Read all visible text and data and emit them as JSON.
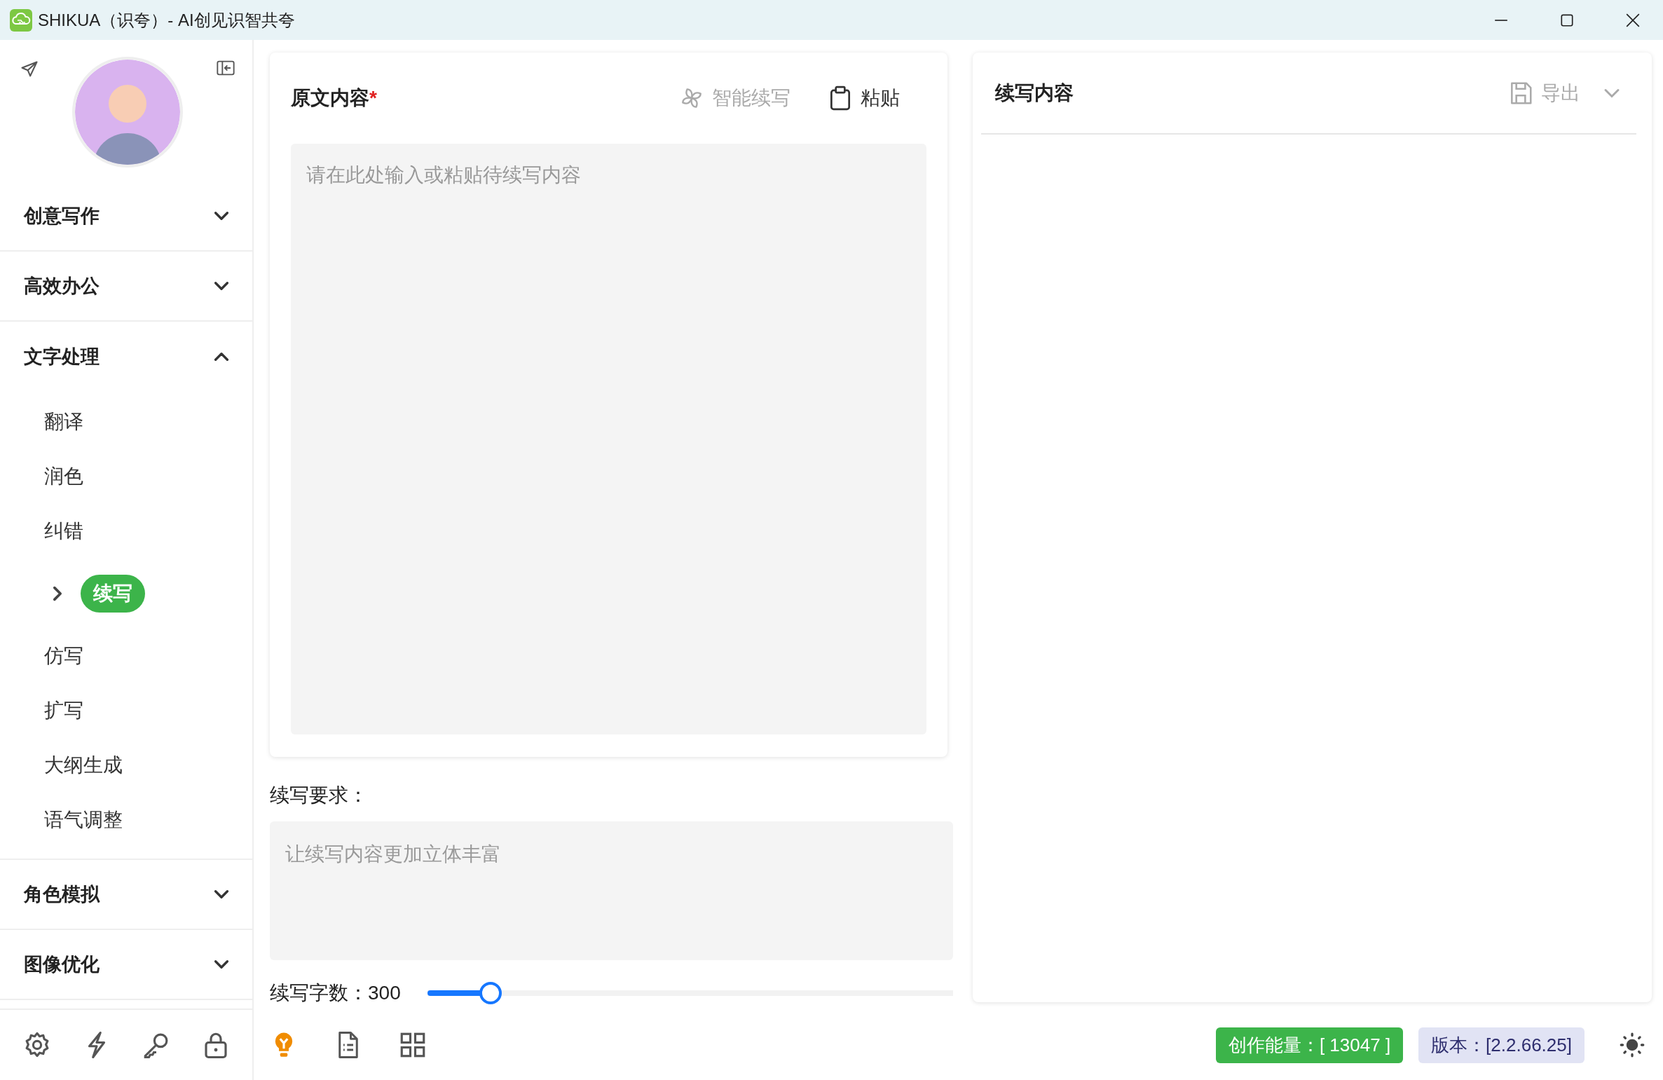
{
  "window": {
    "title": "SHIKUA（识夸）- AI创见识智共夸"
  },
  "sidebar": {
    "groups": [
      {
        "label": "创意写作",
        "expanded": false
      },
      {
        "label": "高效办公",
        "expanded": false
      },
      {
        "label": "文字处理",
        "expanded": true,
        "items": [
          {
            "label": "翻译",
            "selected": false
          },
          {
            "label": "润色",
            "selected": false
          },
          {
            "label": "纠错",
            "selected": false
          },
          {
            "label": "续写",
            "selected": true
          },
          {
            "label": "仿写",
            "selected": false
          },
          {
            "label": "扩写",
            "selected": false
          },
          {
            "label": "大纲生成",
            "selected": false
          },
          {
            "label": "语气调整",
            "selected": false
          }
        ]
      },
      {
        "label": "角色模拟",
        "expanded": false
      },
      {
        "label": "图像优化",
        "expanded": false
      }
    ]
  },
  "source_panel": {
    "title": "原文内容",
    "required_mark": "*",
    "placeholder": "请在此处输入或粘贴待续写内容",
    "actions": [
      {
        "kind": "smart",
        "label": "智能续写",
        "disabled": true
      },
      {
        "kind": "paste",
        "label": "粘贴",
        "disabled": false
      }
    ]
  },
  "requirements": {
    "label": "续写要求：",
    "placeholder": "让续写内容更加立体丰富"
  },
  "word_count": {
    "label": "续写字数：",
    "value": "300",
    "level": 0.12
  },
  "result_panel": {
    "title": "续写内容",
    "export": {
      "label": "导出",
      "disabled": true
    }
  },
  "status": {
    "energy": "创作能量：[ 13047 ]",
    "version": "版本：[2.2.66.25]"
  }
}
